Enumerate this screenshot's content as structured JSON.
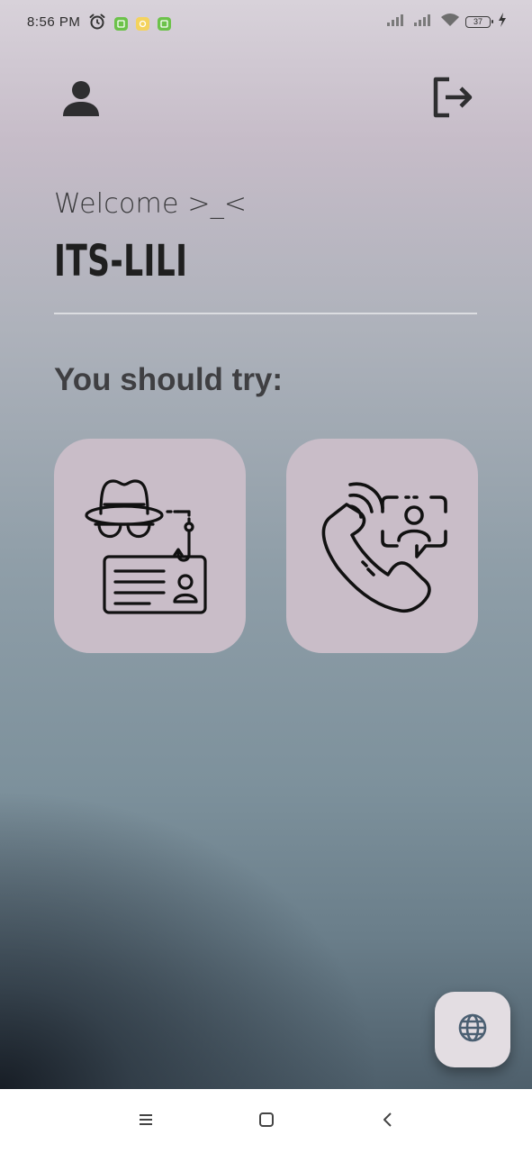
{
  "status_bar": {
    "time": "8:56 PM",
    "battery_level": "37",
    "icons": [
      "alarm-icon",
      "notification-app-icon",
      "notification-app-icon",
      "notification-app-icon",
      "signal-icon",
      "signal-icon",
      "wifi-icon",
      "battery-icon",
      "charging-icon"
    ]
  },
  "header": {
    "profile_icon": "person-icon",
    "logout_icon": "logout-icon"
  },
  "greeting": {
    "welcome_text": "Welcome >_<",
    "username": "ITS-LILI"
  },
  "suggestions": {
    "heading": "You should try:",
    "cards": [
      {
        "icon": "phishing-detective-icon"
      },
      {
        "icon": "phone-call-contact-icon"
      }
    ]
  },
  "fab": {
    "icon": "globe-icon"
  },
  "navigation": {
    "icons": [
      "menu-icon",
      "home-icon",
      "back-icon"
    ]
  },
  "colors": {
    "card_background": "#c9bdc8",
    "fab_background": "#e3dde2",
    "text_dark": "#1f1f1f"
  }
}
